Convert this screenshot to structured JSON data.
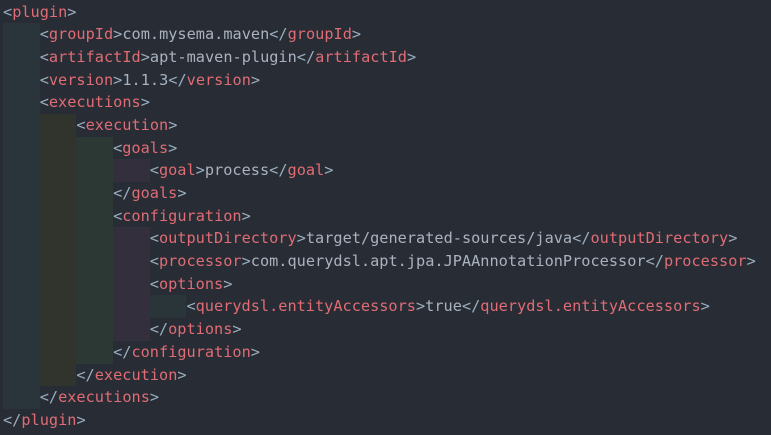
{
  "colors": {
    "background": "#282c34",
    "tag": "#e06c75",
    "bracket": "#9aaec0",
    "text": "#abb2bf",
    "indent_levels": [
      "#29353a",
      "#31342d",
      "#2b3833",
      "#342f3d",
      "#2a3539"
    ]
  },
  "lines": [
    {
      "indent": 0,
      "open": "plugin"
    },
    {
      "indent": 1,
      "open": "groupId",
      "text": "com.mysema.maven",
      "close": "groupId"
    },
    {
      "indent": 1,
      "open": "artifactId",
      "text": "apt-maven-plugin",
      "close": "artifactId"
    },
    {
      "indent": 1,
      "open": "version",
      "text": "1.1.3",
      "close": "version"
    },
    {
      "indent": 1,
      "open": "executions"
    },
    {
      "indent": 2,
      "open": "execution"
    },
    {
      "indent": 3,
      "open": "goals"
    },
    {
      "indent": 4,
      "open": "goal",
      "text": "process",
      "close": "goal"
    },
    {
      "indent": 3,
      "close": "goals"
    },
    {
      "indent": 3,
      "open": "configuration"
    },
    {
      "indent": 4,
      "open": "outputDirectory",
      "text": "target/generated-sources/java",
      "close": "outputDirectory"
    },
    {
      "indent": 4,
      "open": "processor",
      "text": "com.querydsl.apt.jpa.JPAAnnotationProcessor",
      "close": "processor"
    },
    {
      "indent": 4,
      "open": "options"
    },
    {
      "indent": 5,
      "open": "querydsl.entityAccessors",
      "text": "true",
      "close": "querydsl.entityAccessors"
    },
    {
      "indent": 4,
      "close": "options"
    },
    {
      "indent": 3,
      "close": "configuration"
    },
    {
      "indent": 2,
      "close": "execution"
    },
    {
      "indent": 1,
      "close": "executions"
    },
    {
      "indent": 0,
      "close": "plugin"
    }
  ]
}
